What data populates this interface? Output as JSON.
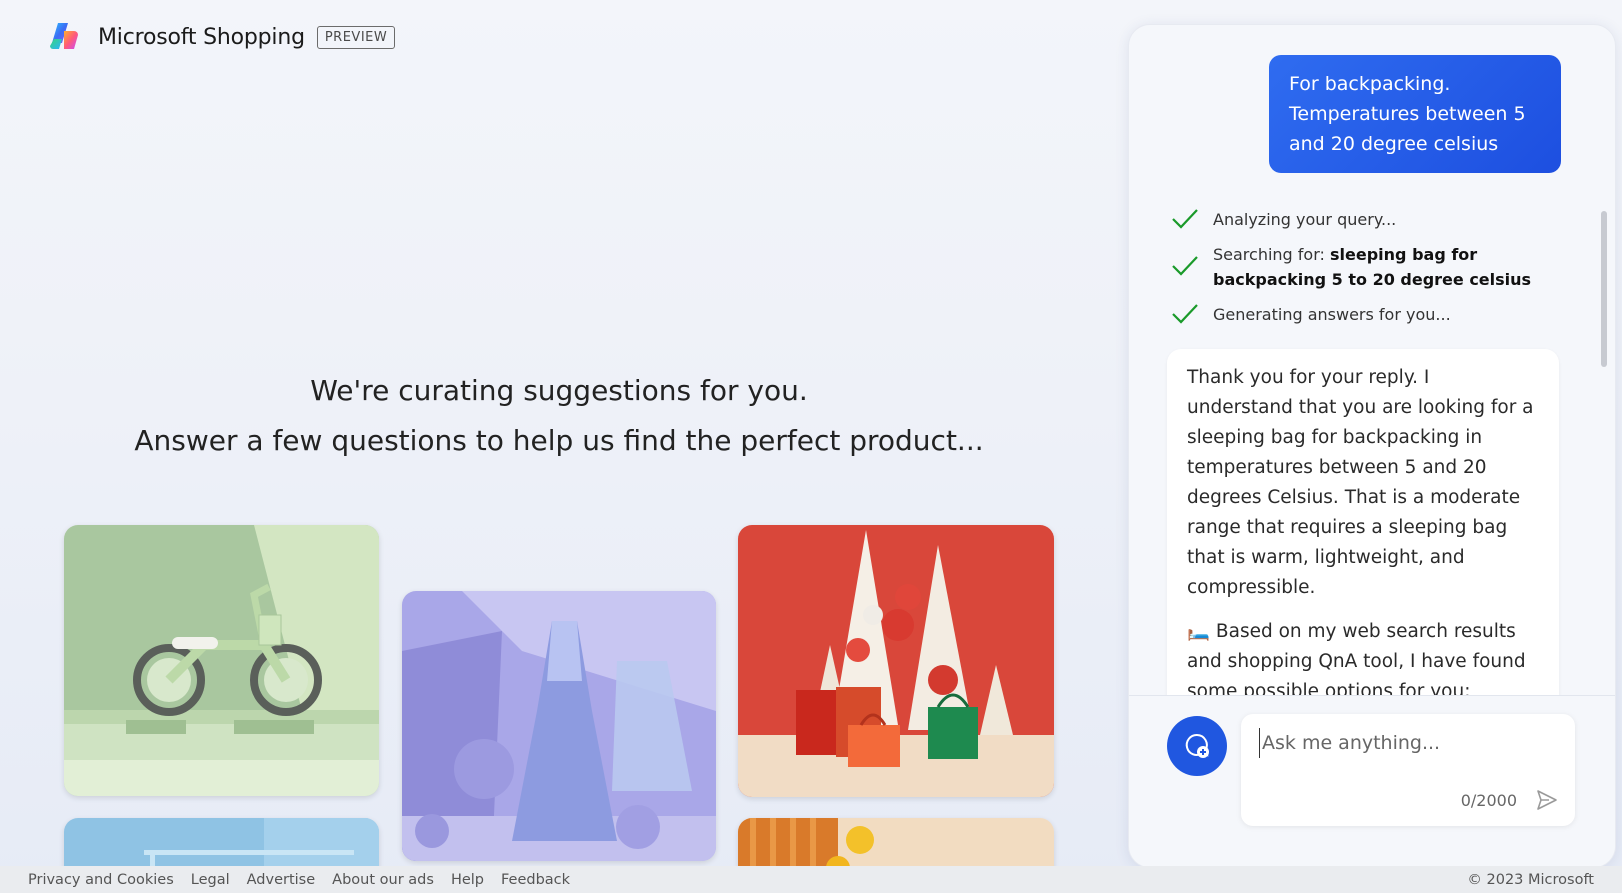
{
  "header": {
    "brand": "Microsoft Shopping",
    "badge": "PREVIEW"
  },
  "main": {
    "line1": "We're curating suggestions for you.",
    "line2": "Answer a few questions to help us find the perfect product..."
  },
  "chat": {
    "user_message": "For backpacking. Temperatures between 5 and 20 degree celsius",
    "status": {
      "analyzing": "Analyzing your query...",
      "searching_prefix": "Searching for: ",
      "searching_query": "sleeping bag for backpacking 5 to 20 degree celsius",
      "generating": "Generating answers for you..."
    },
    "bot_paragraph_1": "Thank you for your reply. I understand that you are looking for a sleeping bag for backpacking in temperatures between 5 and 20 degrees Celsius. That is a moderate range that requires a sleeping bag that is warm, lightweight, and compressible.",
    "bot_paragraph_2": "🛏️ Based on my web search results and shopping QnA tool, I have found some possible options for you:",
    "input_placeholder": "Ask me anything...",
    "char_count": "0/2000"
  },
  "footer": {
    "links": [
      "Privacy and Cookies",
      "Legal",
      "Advertise",
      "About our ads",
      "Help",
      "Feedback"
    ],
    "copyright": "© 2023 Microsoft"
  },
  "colors": {
    "accent": "#1d4fe0",
    "check_green": "#1a9a2a"
  }
}
